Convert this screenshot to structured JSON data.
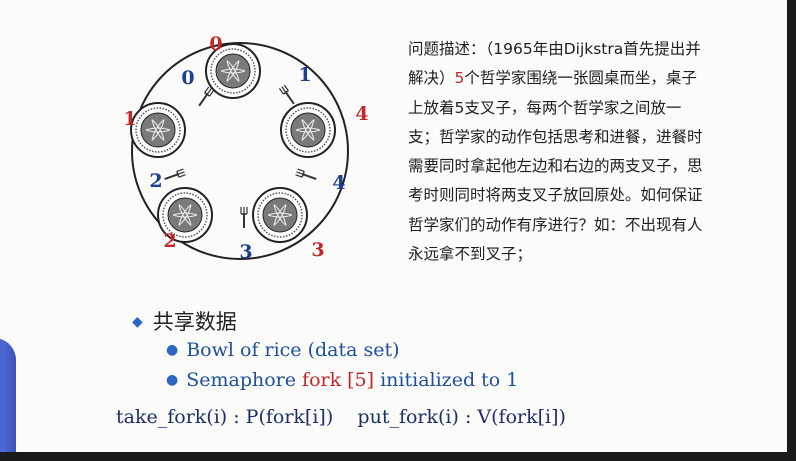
{
  "description": {
    "prefix": "问题描述：（1965年由Dijkstra首先提出并解决）",
    "highlight": "5",
    "suffix": "个哲学家围绕一张圆桌而坐，桌子上放着5支叉子，每两个哲学家之间放一支；哲学家的动作包括思考和进餐，进餐时需要同时拿起他左边和右边的两支叉子，思考时则同时将两支叉子放回原处。如何保证哲学家们的动作有序进行？如：不出现有人永远拿不到叉子；"
  },
  "diagram": {
    "red_labels": [
      "0",
      "1",
      "2",
      "3",
      "4"
    ],
    "blue_labels": [
      "0",
      "1",
      "2",
      "3",
      "4"
    ]
  },
  "shared": {
    "title": "共享数据",
    "bullets": [
      {
        "text": "Bowl of rice (data set)"
      },
      {
        "pre": "Semaphore ",
        "red": "fork [5]",
        "post": " initialized to 1"
      }
    ]
  },
  "operations": {
    "take": "take_fork(i) : P(fork[i])",
    "put": "put_fork(i) : V(fork[i])"
  },
  "colors": {
    "red": "#c3272b",
    "blue": "#1d3f8f",
    "bullet": "#2b66c6"
  }
}
